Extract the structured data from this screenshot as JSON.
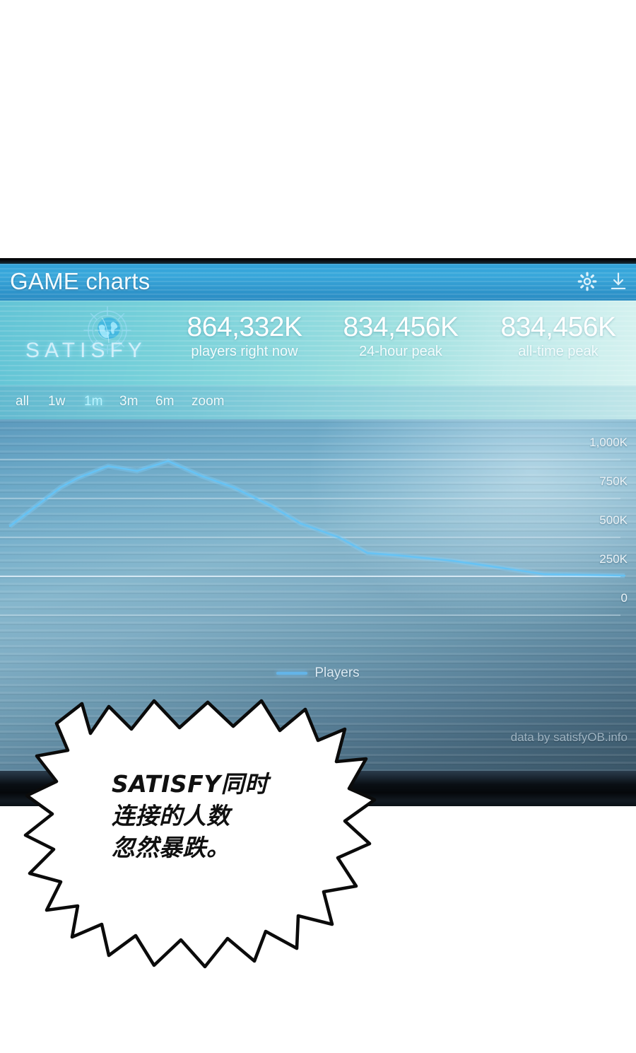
{
  "header": {
    "title": "GAME charts",
    "icons": [
      {
        "name": "gear-icon",
        "label": "settings"
      },
      {
        "name": "download-icon",
        "label": "download"
      }
    ]
  },
  "brand": {
    "name": "SATISFY",
    "logo": "ship-wheel-globe-icon"
  },
  "stats": [
    {
      "value": "864,332K",
      "label": "players right now"
    },
    {
      "value": "834,456K",
      "label": "24-hour peak"
    },
    {
      "value": "834,456K",
      "label": "all-time peak"
    }
  ],
  "ranges": [
    {
      "label": "all",
      "active": false
    },
    {
      "label": "1w",
      "active": false
    },
    {
      "label": "1m",
      "active": true
    },
    {
      "label": "3m",
      "active": false
    },
    {
      "label": "6m",
      "active": false
    },
    {
      "label": "zoom",
      "active": false
    }
  ],
  "chart_labels": {
    "y": [
      "1,000K",
      "750K",
      "500K",
      "250K",
      "0"
    ],
    "legend": "Players",
    "credit": "data by satisfyOB.info"
  },
  "chart_data": {
    "type": "line",
    "title": "",
    "xlabel": "",
    "ylabel": "Players",
    "ylim": [
      0,
      1125000
    ],
    "yticks": [
      0,
      250000,
      500000,
      750000,
      1000000
    ],
    "ytick_labels": [
      "0",
      "250K",
      "500K",
      "750K",
      "1,000K"
    ],
    "grid": true,
    "legend_position": "bottom-center",
    "series": [
      {
        "name": "Players",
        "color": "#63b4e8",
        "x": [
          0,
          10,
          18,
          30,
          38,
          46,
          55,
          62,
          70,
          78,
          86,
          93,
          100
        ],
        "values": [
          355000,
          705000,
          790000,
          900000,
          855000,
          790000,
          700000,
          610000,
          455000,
          390000,
          330000,
          268000,
          252000
        ]
      }
    ]
  },
  "bubble": {
    "text": "SATISFY同时\n连接的人数\n忽然暴跌。"
  },
  "colors": {
    "accent": "#63b4e8",
    "header_blue": "#2f9fd6",
    "brand_glow": "#cfeef8"
  }
}
